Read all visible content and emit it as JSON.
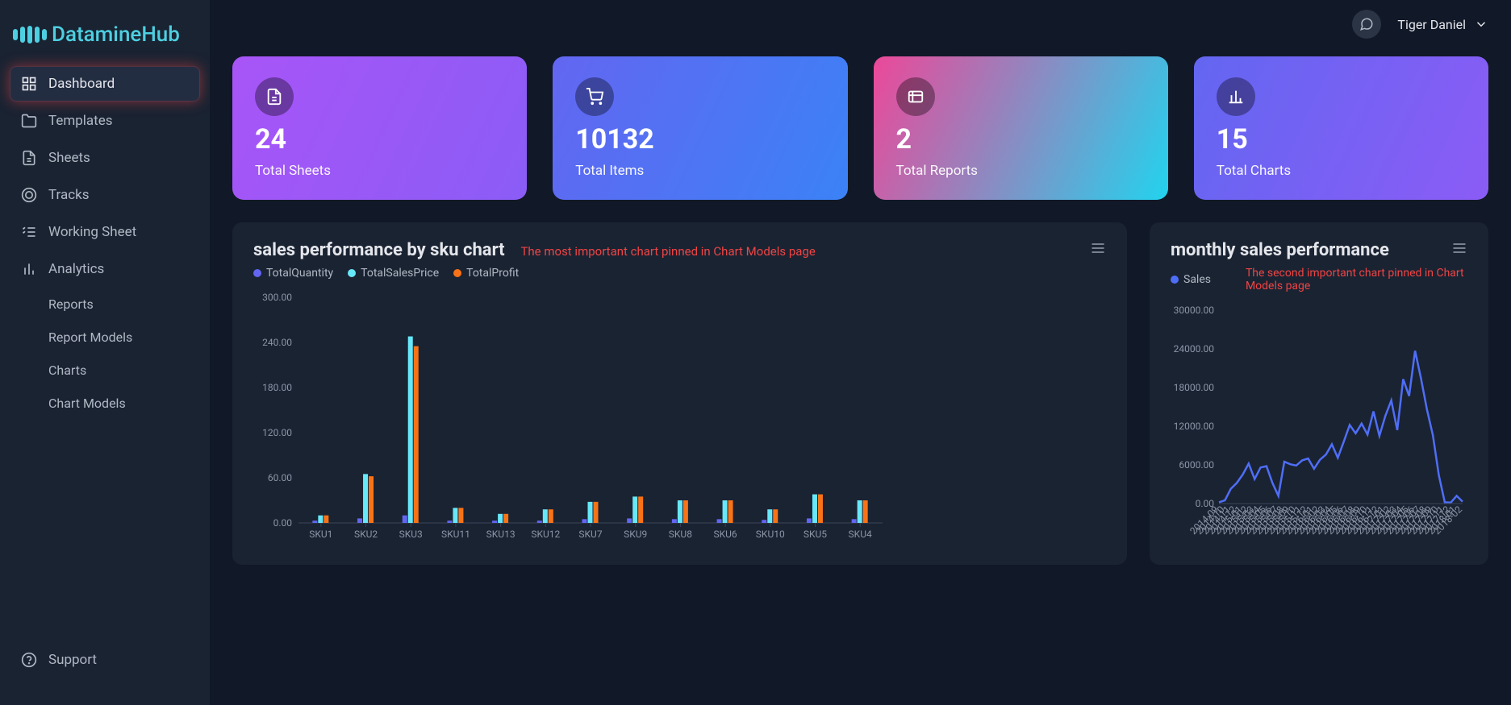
{
  "brand": "DatamineHub",
  "user": {
    "name": "Tiger Daniel"
  },
  "nav": {
    "items": [
      {
        "label": "Dashboard",
        "icon": "grid",
        "active": true
      },
      {
        "label": "Templates",
        "icon": "folder"
      },
      {
        "label": "Sheets",
        "icon": "file"
      },
      {
        "label": "Tracks",
        "icon": "target"
      },
      {
        "label": "Working Sheet",
        "icon": "list-check"
      },
      {
        "label": "Analytics",
        "icon": "bar-chart"
      }
    ],
    "sub": [
      {
        "label": "Reports"
      },
      {
        "label": "Report Models"
      },
      {
        "label": "Charts"
      },
      {
        "label": "Chart Models"
      }
    ],
    "support": {
      "label": "Support",
      "icon": "help"
    }
  },
  "cards": [
    {
      "value": "24",
      "label": "Total Sheets",
      "icon": "doc"
    },
    {
      "value": "10132",
      "label": "Total Items",
      "icon": "cart"
    },
    {
      "value": "2",
      "label": "Total Reports",
      "icon": "list"
    },
    {
      "value": "15",
      "label": "Total Charts",
      "icon": "chart"
    }
  ],
  "chart1": {
    "title": "sales performance by sku chart",
    "annotation": "The most important chart pinned in Chart Models page",
    "legend": [
      {
        "name": "TotalQuantity",
        "color": "#6366f1"
      },
      {
        "name": "TotalSalesPrice",
        "color": "#67e8f9"
      },
      {
        "name": "TotalProfit",
        "color": "#f97316"
      }
    ]
  },
  "chart2": {
    "title": "monthly sales performance",
    "annotation": "The second important chart pinned in Chart Models page",
    "legend": [
      {
        "name": "Sales",
        "color": "#4f6ef7"
      }
    ]
  },
  "chart_data": [
    {
      "type": "bar",
      "title": "sales performance by sku chart",
      "ylabel": "",
      "ylim": [
        0,
        300
      ],
      "yticks": [
        0,
        60,
        120,
        180,
        240,
        300
      ],
      "categories": [
        "SKU1",
        "SKU2",
        "SKU3",
        "SKU11",
        "SKU13",
        "SKU12",
        "SKU7",
        "SKU9",
        "SKU8",
        "SKU6",
        "SKU10",
        "SKU5",
        "SKU4"
      ],
      "series": [
        {
          "name": "TotalQuantity",
          "color": "#6366f1",
          "values": [
            3,
            6,
            10,
            3,
            3,
            3,
            5,
            6,
            5,
            5,
            4,
            6,
            5
          ]
        },
        {
          "name": "TotalSalesPrice",
          "color": "#67e8f9",
          "values": [
            10,
            65,
            248,
            20,
            12,
            18,
            28,
            35,
            30,
            30,
            18,
            38,
            30
          ]
        },
        {
          "name": "TotalProfit",
          "color": "#f97316",
          "values": [
            10,
            62,
            235,
            20,
            12,
            18,
            28,
            35,
            30,
            30,
            18,
            38,
            30
          ]
        }
      ]
    },
    {
      "type": "line",
      "title": "monthly sales performance",
      "ylabel": "",
      "ylim": [
        0,
        30000
      ],
      "yticks": [
        0,
        6000,
        12000,
        18000,
        24000,
        30000
      ],
      "x": [
        "2014-09",
        "2014-10",
        "2014-11",
        "2014-12",
        "2015-01",
        "2015-02",
        "2015-03",
        "2015-04",
        "2015-05",
        "2015-06",
        "2015-07",
        "2015-08",
        "2015-09",
        "2015-10",
        "2015-11",
        "2015-12",
        "2016-01",
        "2016-02",
        "2016-03",
        "2016-04",
        "2016-05",
        "2016-06",
        "2016-07",
        "2016-08",
        "2016-09",
        "2016-10",
        "2016-11",
        "2016-12",
        "2017-01",
        "2017-02",
        "2017-03",
        "2017-04",
        "2017-05",
        "2017-06",
        "2017-07",
        "2017-08",
        "2017-09",
        "2017-10",
        "2017-11",
        "2017-12",
        "2018-01",
        "2018-02"
      ],
      "series": [
        {
          "name": "Sales",
          "color": "#4f6ef7",
          "values": [
            200,
            500,
            2300,
            3200,
            4500,
            6200,
            3800,
            5600,
            5800,
            3200,
            1200,
            6500,
            6100,
            5900,
            6700,
            7000,
            5400,
            6800,
            7600,
            9200,
            7100,
            9600,
            12200,
            10900,
            12400,
            10700,
            14300,
            10500,
            13600,
            16000,
            11400,
            19300,
            16700,
            23700,
            19400,
            14600,
            10600,
            4400,
            200,
            150,
            1200,
            300
          ]
        }
      ]
    }
  ]
}
